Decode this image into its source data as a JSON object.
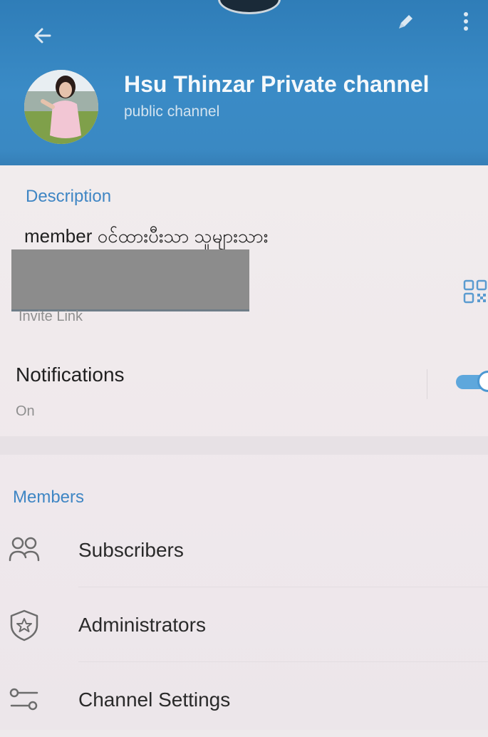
{
  "header": {
    "title": "Hsu Thinzar Private channel",
    "subtitle": "public channel",
    "back_icon": "arrow-left-icon",
    "edit_icon": "pencil-icon",
    "more_icon": "more-vertical-icon",
    "background_color": "#3a88c2"
  },
  "description": {
    "label": "Description",
    "text": "member ဝင်ထားပီးသာ သူများသား"
  },
  "invite": {
    "label": "Invite Link",
    "qr_icon": "qr-code-icon"
  },
  "notifications": {
    "label": "Notifications",
    "status": "On",
    "enabled": true
  },
  "members": {
    "label": "Members",
    "items": [
      {
        "label": "Subscribers",
        "icon": "people-icon"
      },
      {
        "label": "Administrators",
        "icon": "shield-star-icon"
      },
      {
        "label": "Channel Settings",
        "icon": "sliders-icon"
      }
    ]
  },
  "colors": {
    "accent": "#3f86c4",
    "toggle": "#5ea7dc"
  }
}
